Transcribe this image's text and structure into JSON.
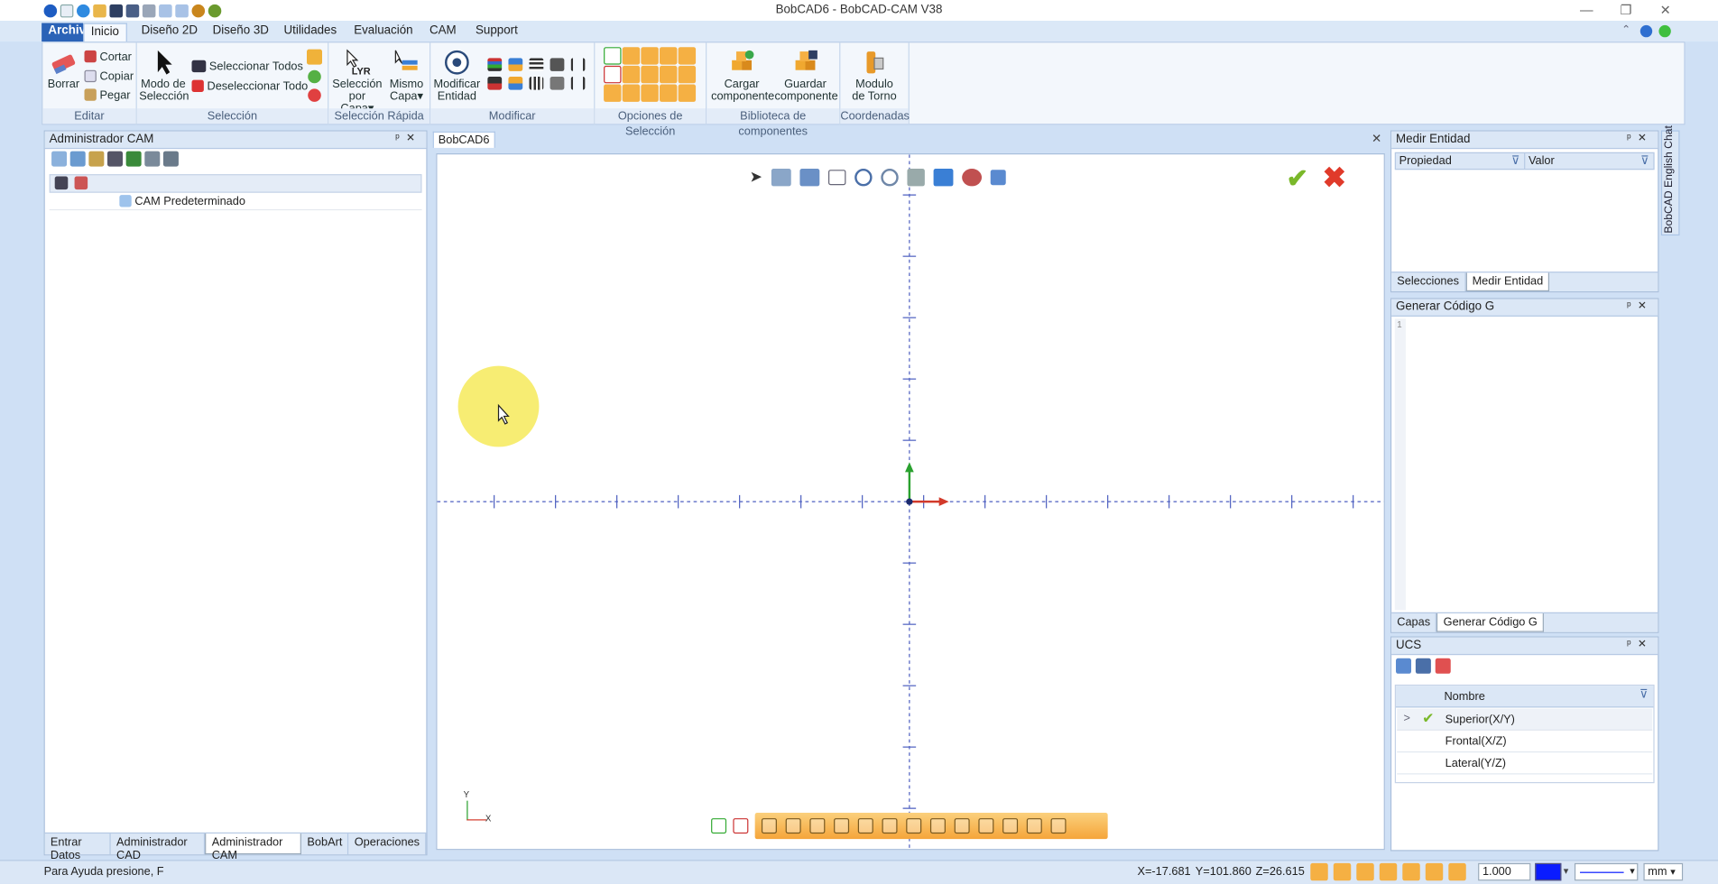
{
  "window": {
    "title": "BobCAD6 - BobCAD-CAM V38"
  },
  "menu_tabs": [
    {
      "label": "Archivo"
    },
    {
      "label": "Inicio"
    },
    {
      "label": "Diseño 2D"
    },
    {
      "label": "Diseño 3D"
    },
    {
      "label": "Utilidades"
    },
    {
      "label": "Evaluación"
    },
    {
      "label": "CAM"
    },
    {
      "label": "Support"
    }
  ],
  "ribbon": {
    "editar": {
      "label": "Editar",
      "borrar": "Borrar",
      "cortar": "Cortar",
      "copiar": "Copiar",
      "pegar": "Pegar"
    },
    "seleccion": {
      "label": "Selección",
      "modo_l1": "Modo de",
      "modo_l2": "Selección",
      "sel_todos": "Seleccionar Todos",
      "desel_todo": "Deseleccionar Todo"
    },
    "rapida": {
      "label": "Selección Rápida",
      "capa_l1": "Selección",
      "capa_l2": "por Capa",
      "mismo_l1": "Mismo",
      "mismo_l2": "Capa"
    },
    "modificar": {
      "label": "Modificar",
      "mod_l1": "Modificar",
      "mod_l2": "Entidad"
    },
    "opciones": {
      "label": "Opciones de Selección"
    },
    "biblioteca": {
      "label": "Biblioteca de componentes",
      "cargar_l1": "Cargar",
      "cargar_l2": "componente",
      "guardar_l1": "Guardar",
      "guardar_l2": "componente"
    },
    "coordenadas": {
      "label": "Coordenadas",
      "torno_l1": "Modulo",
      "torno_l2": "de Torno"
    }
  },
  "left_panel": {
    "title": "Administrador CAM",
    "tree_item": "CAM Predeterminado",
    "bottom_tabs": [
      {
        "label": "Entrar Datos"
      },
      {
        "label": "Administrador CAD"
      },
      {
        "label": "Administrador CAM"
      },
      {
        "label": "BobArt"
      },
      {
        "label": "Operaciones"
      }
    ]
  },
  "viewport": {
    "tab": "BobCAD6",
    "axis_y": "Y",
    "axis_x": "X"
  },
  "medir_panel": {
    "title": "Medir Entidad",
    "col_prop": "Propiedad",
    "col_valor": "Valor",
    "tab1": "Selecciones",
    "tab2": "Medir Entidad"
  },
  "gcode_panel": {
    "title": "Generar Código G",
    "line1": "1",
    "tab1": "Capas",
    "tab2": "Generar Código G"
  },
  "ucs_panel": {
    "title": "UCS",
    "col_name": "Nombre",
    "rows": [
      {
        "expand": ">",
        "name": "Superior(X/Y)"
      },
      {
        "name": "Frontal(X/Z)"
      },
      {
        "name": "Lateral(Y/Z)"
      }
    ]
  },
  "side_tab": {
    "label": "BobCAD English Chat"
  },
  "status": {
    "help": "Para Ayuda presione, F",
    "x": "X=-17.681",
    "y": "Y=101.860",
    "z": "Z=26.615",
    "scale": "1.000",
    "units": "mm"
  },
  "colors": {
    "accent": "#2b63b7",
    "x_axis": "#d23a2a",
    "y_axis": "#2aa12f",
    "selection_bar": "#f5b043"
  }
}
